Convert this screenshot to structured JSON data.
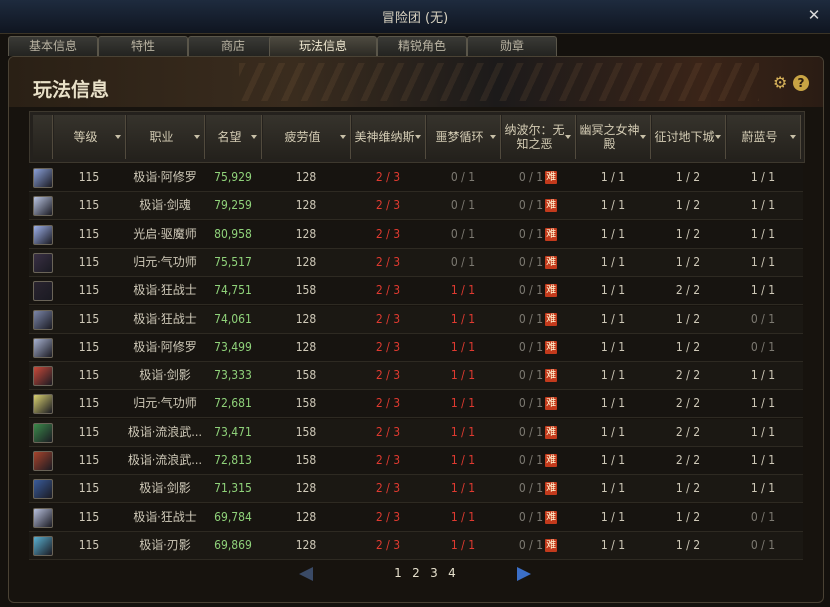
{
  "window": {
    "title": "冒险团 (无)",
    "close_label": "✕"
  },
  "tabs": [
    "基本信息",
    "特性",
    "商店",
    "玩法信息",
    "精锐角色",
    "勋章"
  ],
  "active_tab": 3,
  "panel": {
    "heading": "玩法信息",
    "gear_icon": "gear-icon",
    "help_label": "?"
  },
  "table": {
    "columns": [
      "等级",
      "职业",
      "名望",
      "疲劳值",
      "美神维纳斯",
      "噩梦循环",
      "纳波尔：无知之恶",
      "幽冥之女神殿",
      "征讨地下城",
      "蔚蓝号"
    ],
    "tag_label": "难",
    "rows": [
      {
        "level": "115",
        "job": "极诣·阿修罗",
        "fame": "75,929",
        "fatigue": "128",
        "venus": "2 / 3",
        "nightmare": "0 / 1",
        "napol": "0 / 1",
        "goddess": "1 / 1",
        "dungeon": "1 / 2",
        "azure": "1 / 1",
        "avatar_color": "#8aa0d8"
      },
      {
        "level": "115",
        "job": "极诣·剑魂",
        "fame": "79,259",
        "fatigue": "128",
        "venus": "2 / 3",
        "nightmare": "0 / 1",
        "napol": "0 / 1",
        "goddess": "1 / 1",
        "dungeon": "1 / 2",
        "azure": "1 / 1",
        "avatar_color": "#b9c4e0"
      },
      {
        "level": "115",
        "job": "光启·驱魔师",
        "fame": "80,958",
        "fatigue": "128",
        "venus": "2 / 3",
        "nightmare": "0 / 1",
        "napol": "0 / 1",
        "goddess": "1 / 1",
        "dungeon": "1 / 2",
        "azure": "1 / 1",
        "avatar_color": "#9db0e8"
      },
      {
        "level": "115",
        "job": "归元·气功师",
        "fame": "75,517",
        "fatigue": "128",
        "venus": "2 / 3",
        "nightmare": "0 / 1",
        "napol": "0 / 1",
        "goddess": "1 / 1",
        "dungeon": "1 / 2",
        "azure": "1 / 1",
        "avatar_color": "#3a3044"
      },
      {
        "level": "115",
        "job": "极诣·狂战士",
        "fame": "74,751",
        "fatigue": "158",
        "venus": "2 / 3",
        "nightmare": "1 / 1",
        "napol": "0 / 1",
        "goddess": "1 / 1",
        "dungeon": "2 / 2",
        "azure": "1 / 1",
        "avatar_color": "#2a2430"
      },
      {
        "level": "115",
        "job": "极诣·狂战士",
        "fame": "74,061",
        "fatigue": "128",
        "venus": "2 / 3",
        "nightmare": "1 / 1",
        "napol": "0 / 1",
        "goddess": "1 / 1",
        "dungeon": "1 / 2",
        "azure": "0 / 1",
        "avatar_color": "#7b86a8"
      },
      {
        "level": "115",
        "job": "极诣·阿修罗",
        "fame": "73,499",
        "fatigue": "128",
        "venus": "2 / 3",
        "nightmare": "1 / 1",
        "napol": "0 / 1",
        "goddess": "1 / 1",
        "dungeon": "1 / 2",
        "azure": "0 / 1",
        "avatar_color": "#a8b2d0"
      },
      {
        "level": "115",
        "job": "极诣·剑影",
        "fame": "73,333",
        "fatigue": "158",
        "venus": "2 / 3",
        "nightmare": "1 / 1",
        "napol": "0 / 1",
        "goddess": "1 / 1",
        "dungeon": "2 / 2",
        "azure": "1 / 1",
        "avatar_color": "#c84a3a"
      },
      {
        "level": "115",
        "job": "归元·气功师",
        "fame": "72,681",
        "fatigue": "158",
        "venus": "2 / 3",
        "nightmare": "1 / 1",
        "napol": "0 / 1",
        "goddess": "1 / 1",
        "dungeon": "2 / 2",
        "azure": "1 / 1",
        "avatar_color": "#d8d070"
      },
      {
        "level": "115",
        "job": "极诣·流浪武…",
        "fame": "73,471",
        "fatigue": "158",
        "venus": "2 / 3",
        "nightmare": "1 / 1",
        "napol": "0 / 1",
        "goddess": "1 / 1",
        "dungeon": "2 / 2",
        "azure": "1 / 1",
        "avatar_color": "#3c8a4a"
      },
      {
        "level": "115",
        "job": "极诣·流浪武…",
        "fame": "72,813",
        "fatigue": "158",
        "venus": "2 / 3",
        "nightmare": "1 / 1",
        "napol": "0 / 1",
        "goddess": "1 / 1",
        "dungeon": "2 / 2",
        "azure": "1 / 1",
        "avatar_color": "#a8442c"
      },
      {
        "level": "115",
        "job": "极诣·剑影",
        "fame": "71,315",
        "fatigue": "128",
        "venus": "2 / 3",
        "nightmare": "1 / 1",
        "napol": "0 / 1",
        "goddess": "1 / 1",
        "dungeon": "1 / 2",
        "azure": "1 / 1",
        "avatar_color": "#3a5c9a"
      },
      {
        "level": "115",
        "job": "极诣·狂战士",
        "fame": "69,784",
        "fatigue": "128",
        "venus": "2 / 3",
        "nightmare": "1 / 1",
        "napol": "0 / 1",
        "goddess": "1 / 1",
        "dungeon": "1 / 2",
        "azure": "0 / 1",
        "avatar_color": "#b8c0dc"
      },
      {
        "level": "115",
        "job": "极诣·刃影",
        "fame": "69,869",
        "fatigue": "128",
        "venus": "2 / 3",
        "nightmare": "1 / 1",
        "napol": "0 / 1",
        "goddess": "1 / 1",
        "dungeon": "1 / 2",
        "azure": "0 / 1",
        "avatar_color": "#5ab0d0"
      }
    ]
  },
  "pager": {
    "pages": [
      "1",
      "2",
      "3",
      "4"
    ],
    "prev_icon": "triangle-left-icon",
    "next_icon": "triangle-right-icon"
  },
  "colors": {
    "fame": "#8fd27a",
    "red": "#e03a30",
    "dim": "#7d7a72",
    "accent": "#3b6fc8"
  }
}
